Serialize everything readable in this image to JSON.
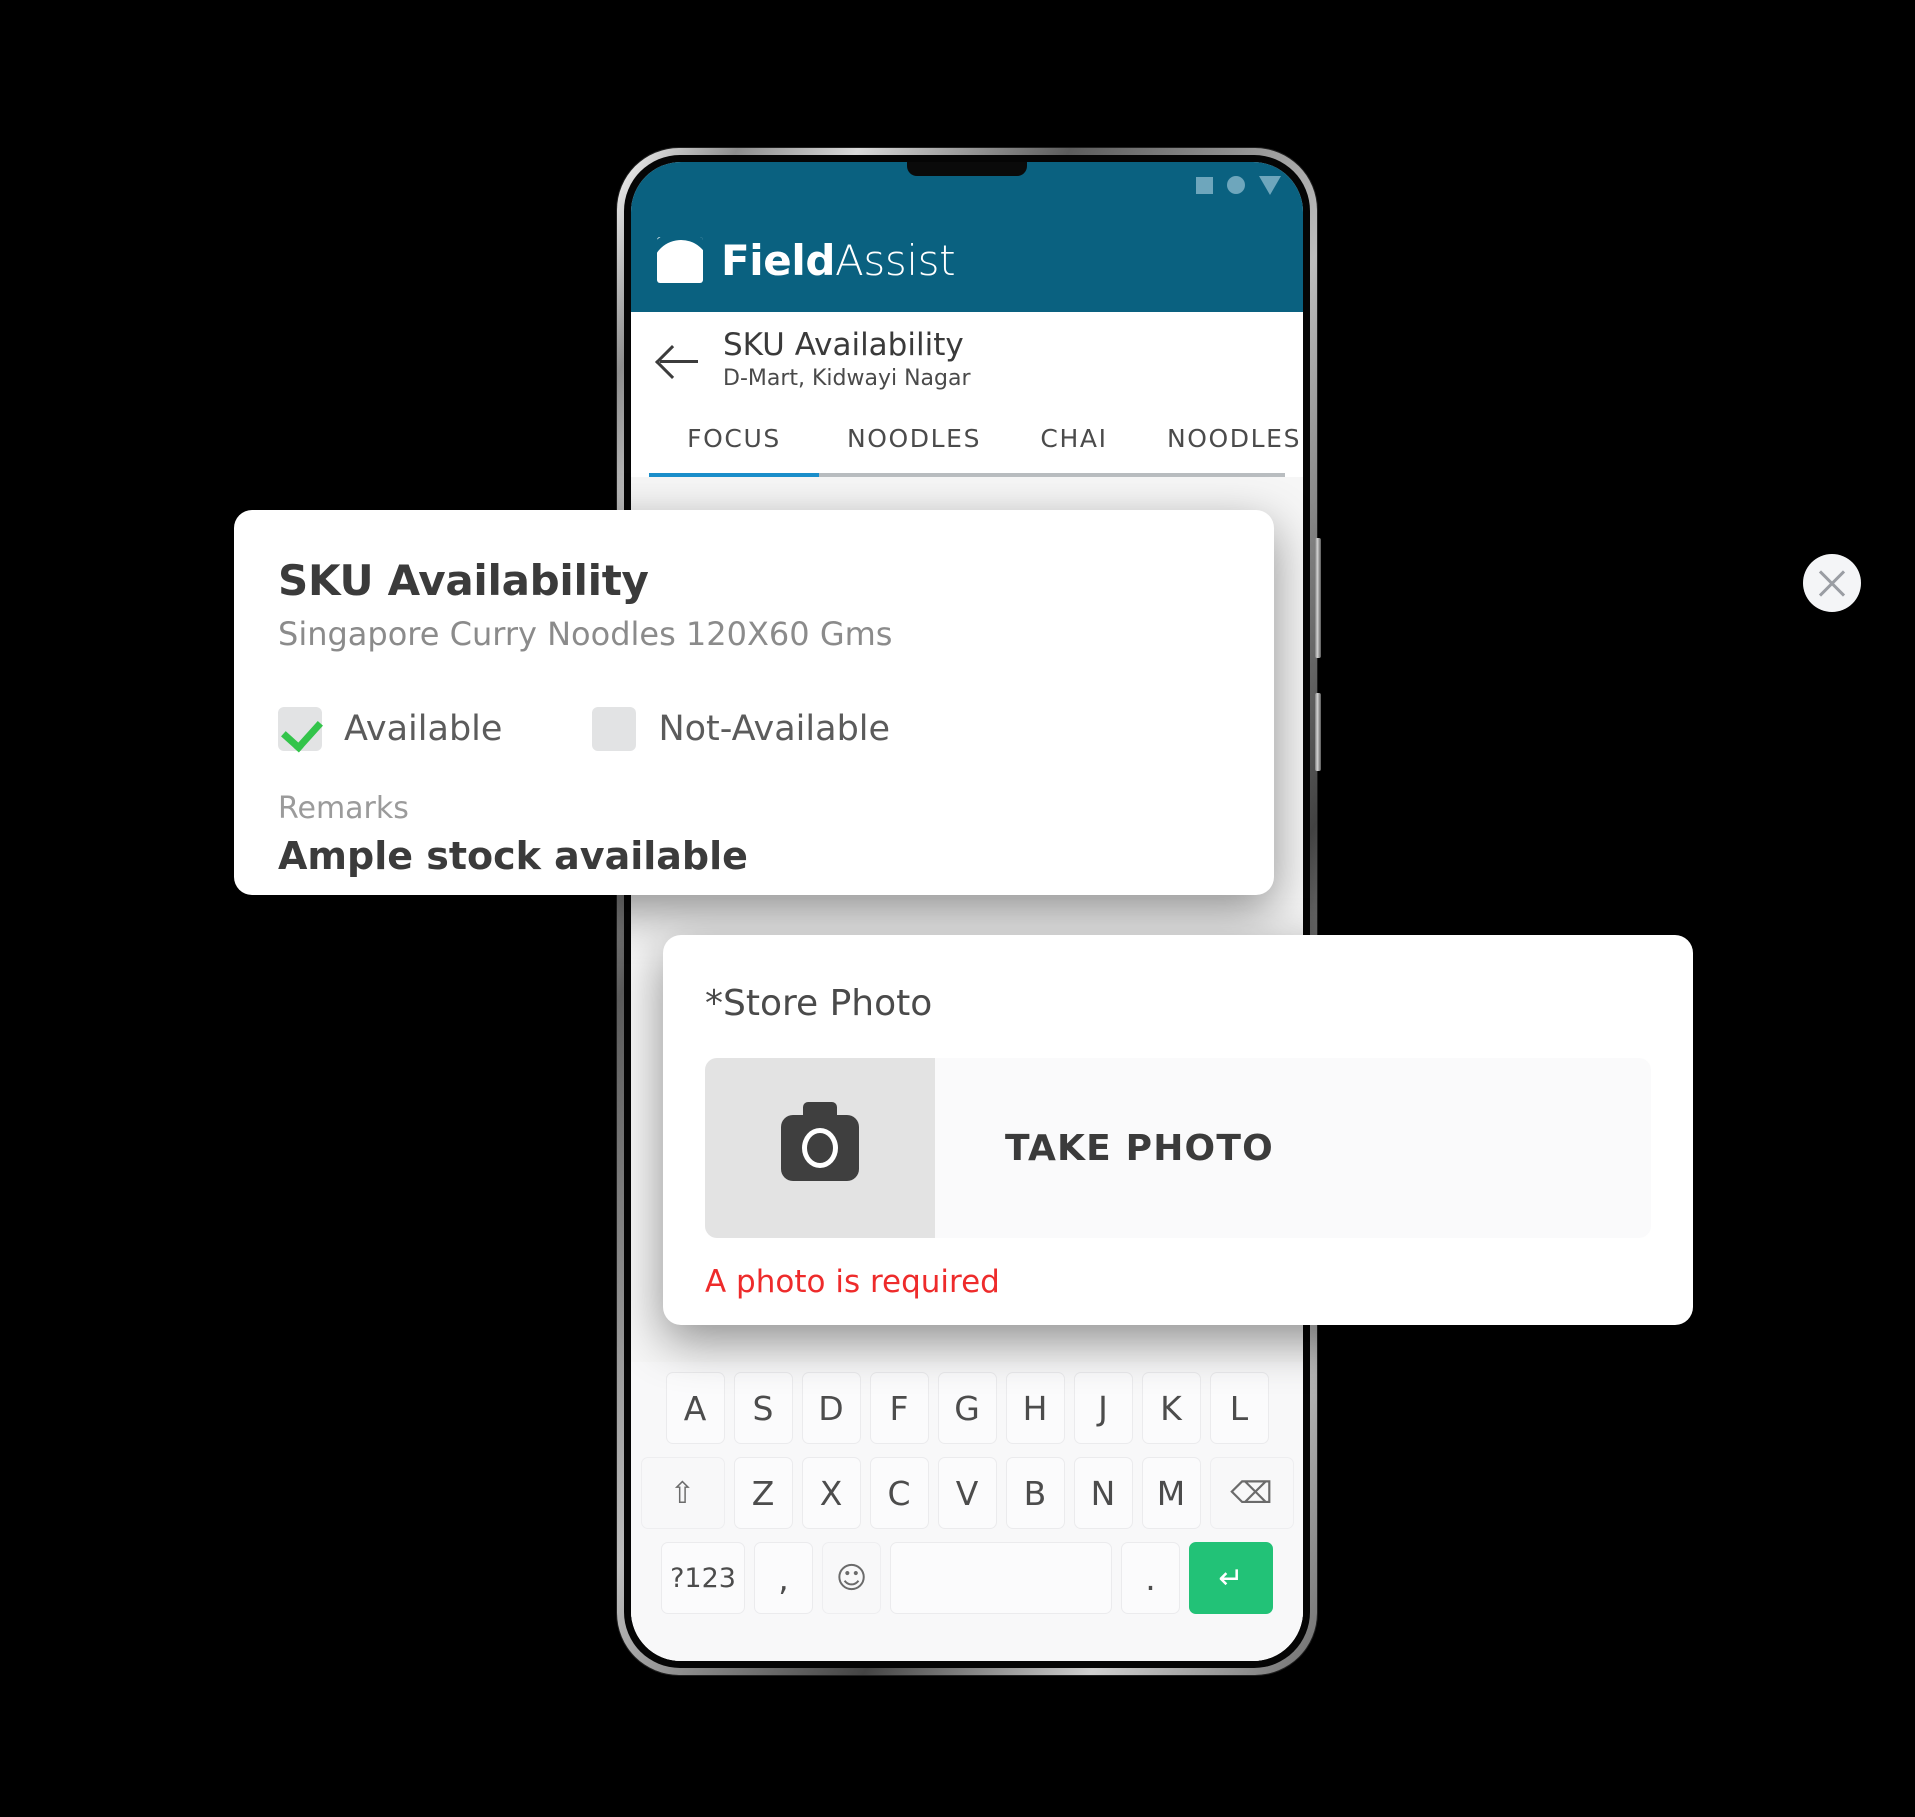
{
  "device": {
    "statusbar_icons": [
      "square-icon",
      "circle-icon",
      "triangle-down-icon"
    ]
  },
  "app": {
    "brand_bold": "Field",
    "brand_light": "Assist",
    "brand_color": "#0a6180",
    "logo_icon": "fieldassist-logo-icon"
  },
  "nav": {
    "back_icon": "back-arrow-icon",
    "title": "SKU Availability",
    "subtitle": "D-Mart, Kidwayi Nagar"
  },
  "tabs": {
    "items": [
      {
        "label": "FOCUS",
        "active": true
      },
      {
        "label": "NOODLES",
        "active": false
      },
      {
        "label": "CHAI",
        "active": false
      },
      {
        "label": "NOODLES",
        "active": false
      }
    ],
    "indicator_color": "#1b8fcb"
  },
  "sku_dialog": {
    "title": "SKU Availability",
    "subtitle": "Singapore Curry Noodles 120X60 Gms",
    "close_icon": "close-icon",
    "options": [
      {
        "label": "Available",
        "checked": true,
        "check_color": "#33c44a"
      },
      {
        "label": "Not-Available",
        "checked": false
      }
    ],
    "remarks_label": "Remarks",
    "remarks_value": "Ample stock available"
  },
  "photo_card": {
    "label": "*Store Photo",
    "button_label": "TAKE PHOTO",
    "camera_icon": "camera-icon",
    "error_text": "A photo is required",
    "error_color": "#ee2b2b"
  },
  "keyboard": {
    "row_home": [
      "A",
      "S",
      "D",
      "F",
      "G",
      "H",
      "J",
      "K",
      "L"
    ],
    "shift_icon": "shift-up-icon",
    "row_bottom_letters": [
      "Z",
      "X",
      "C",
      "V",
      "B",
      "N",
      "M"
    ],
    "backspace_icon": "backspace-icon",
    "symbols_key": "?123",
    "comma_key": ",",
    "emoji_icon": "emoji-smiley-icon",
    "space_key": "",
    "period_key": ".",
    "enter_icon": "enter-return-icon",
    "enter_color": "#22c277"
  }
}
